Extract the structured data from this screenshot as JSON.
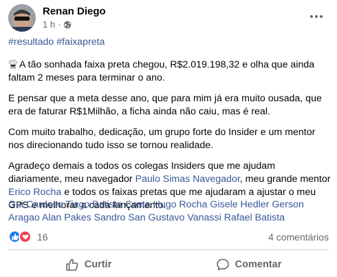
{
  "post": {
    "author": "Renan Diego",
    "time": "1 h",
    "separator": "·",
    "hashtags": [
      "#resultado",
      "#faixapreta"
    ],
    "paragraphs": {
      "p1": "A tão sonhada faixa preta chegou, R$2.019.198,32 e olha que ainda faltam 2 meses para terminar o ano.",
      "p2": "E pensar que a meta desse ano, que para mim já era muito ousada, que era de faturar R$1Milhão, a ficha ainda não caiu, mas é real.",
      "p3": "Com muito trabalho, dedicação, um grupo forte do Insider e um mentor nos direcionando tudo isso se tornou realidade.",
      "p4_a": "Agradeço demais a todos os colegas Insiders que me ajudam diariamente, meu navegador ",
      "p4_link1": "Paulo Simas Navegador",
      "p4_b": ", meu grande mentor ",
      "p4_link2": "Erico Rocha",
      "p4_c": " e todos os faixas pretas que me ajudaram a ajustar o meu GPS e melhorar a cada lançamento."
    },
    "tagged": [
      "Gui Cardoso",
      "Tiago Batista Costa",
      "Hugo Rocha",
      "Gisele Hedler",
      "Gerson Aragao",
      "Alan Pakes",
      "Sandro San",
      "Gustavo Vanassi",
      "Rafael Batista"
    ]
  },
  "stats": {
    "reaction_count": "16",
    "comments": "4 comentários"
  },
  "actions": {
    "like": "Curtir",
    "comment": "Comentar"
  },
  "icons": {
    "privacy": "globe-icon",
    "menu": "more-options-icon",
    "emoji": "martial-arts-uniform-icon",
    "reaction_1": "like-reaction-icon",
    "reaction_2": "love-reaction-icon",
    "like_action": "thumbs-up-icon",
    "comment_action": "comment-bubble-icon"
  },
  "colors": {
    "link": "#385898",
    "secondary_text": "#65676b",
    "like_blue": "#1877f2",
    "love_red": "#f33e58"
  }
}
